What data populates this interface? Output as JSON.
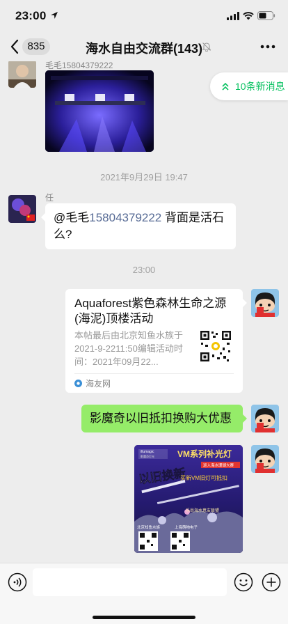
{
  "status_bar": {
    "time": "23:00"
  },
  "nav": {
    "unread_count": "835",
    "title": "海水自由交流群(143)"
  },
  "new_messages_pill": {
    "label": "10条新消息"
  },
  "messages": {
    "first_sender": "毛毛15804379222",
    "time_label_1": "2021年9月29日 19:47",
    "second_sender": "任",
    "mention_prefix": "@毛毛",
    "mention_number": "15804379222",
    "mention_rest": " 背面是活石么?",
    "time_label_2": "23:00",
    "card": {
      "title": "Aquaforest紫色森林生命之源(海泥)顶楼活动",
      "description": "本帖最后由北京知鱼水族于2021-9-2211:50编辑活动时间：2021年09月22...",
      "source": "海友网"
    },
    "green_text": "影魔奇以旧抵扣换购大优惠",
    "poster": {
      "brand": "illumagic",
      "brand_sub": "影魔奇灯光",
      "heading": "VM系列补光灯",
      "sub_heading": "巡入海水珊瑚大赛",
      "big_text": "以旧换新",
      "trade_text": "买新VM旧灯可抵扣",
      "store_line": "乐尚海水意友联盟",
      "footer_left": "北京知鱼水族",
      "footer_right": "上海萌物电子"
    }
  },
  "input": {
    "placeholder": ""
  },
  "colors": {
    "accent_green": "#07c160",
    "bubble_green": "#95ec69",
    "link_blue": "#576b95"
  }
}
